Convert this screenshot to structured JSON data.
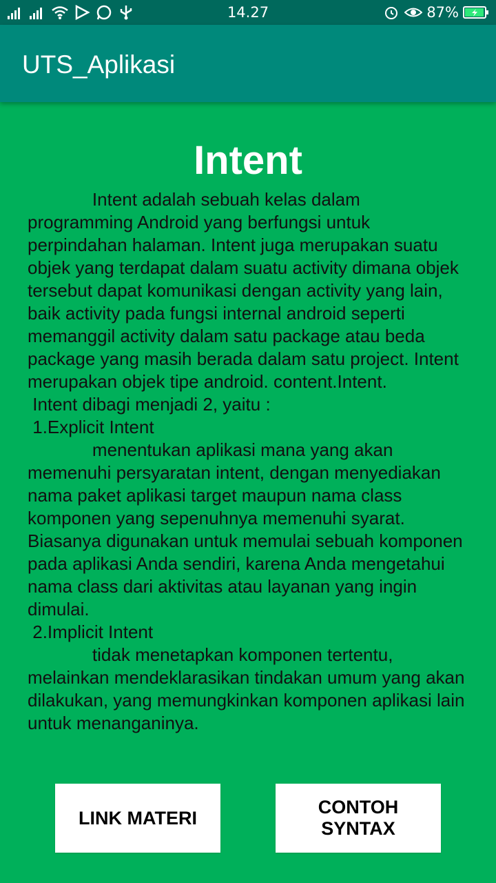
{
  "status_bar": {
    "time": "14.27",
    "battery": "87%",
    "icons_left": [
      "signal-icon",
      "signal-icon",
      "wifi-icon",
      "play-store-icon",
      "whatsapp-icon",
      "usb-icon"
    ],
    "icons_right": [
      "alarm-icon",
      "eye-icon",
      "battery-charging-icon"
    ]
  },
  "app_bar": {
    "title": "UTS_Aplikasi"
  },
  "main": {
    "heading": "Intent",
    "paragraphs": [
      "             Intent adalah sebuah kelas dalam programming Android yang berfungsi untuk perpindahan halaman. Intent juga merupakan suatu objek yang terdapat dalam suatu activity dimana objek tersebut dapat komunikasi dengan activity yang lain, baik activity pada fungsi internal android seperti memanggil activity dalam satu package atau beda package yang masih berada dalam satu project. Intent merupakan objek tipe android. content.Intent.",
      " Intent dibagi menjadi 2, yaitu :",
      " 1.Explicit Intent",
      "             menentukan aplikasi mana yang akan memenuhi persyaratan intent, dengan menyediakan nama paket aplikasi target maupun nama class komponen yang sepenuhnya memenuhi syarat. Biasanya digunakan untuk memulai sebuah komponen pada aplikasi Anda sendiri, karena Anda mengetahui nama class dari aktivitas atau layanan yang ingin dimulai.",
      " 2.Implicit Intent",
      "             tidak menetapkan komponen tertentu, melainkan mendeklarasikan tindakan umum yang akan dilakukan, yang memungkinkan komponen aplikasi lain untuk menanganinya."
    ]
  },
  "buttons": {
    "link_materi": "LINK MATERI",
    "contoh_syntax": "CONTOH SYNTAX"
  },
  "colors": {
    "status_bar": "#00695c",
    "app_bar": "#00897b",
    "background": "#00b05a",
    "heading_text": "#ffffff"
  }
}
